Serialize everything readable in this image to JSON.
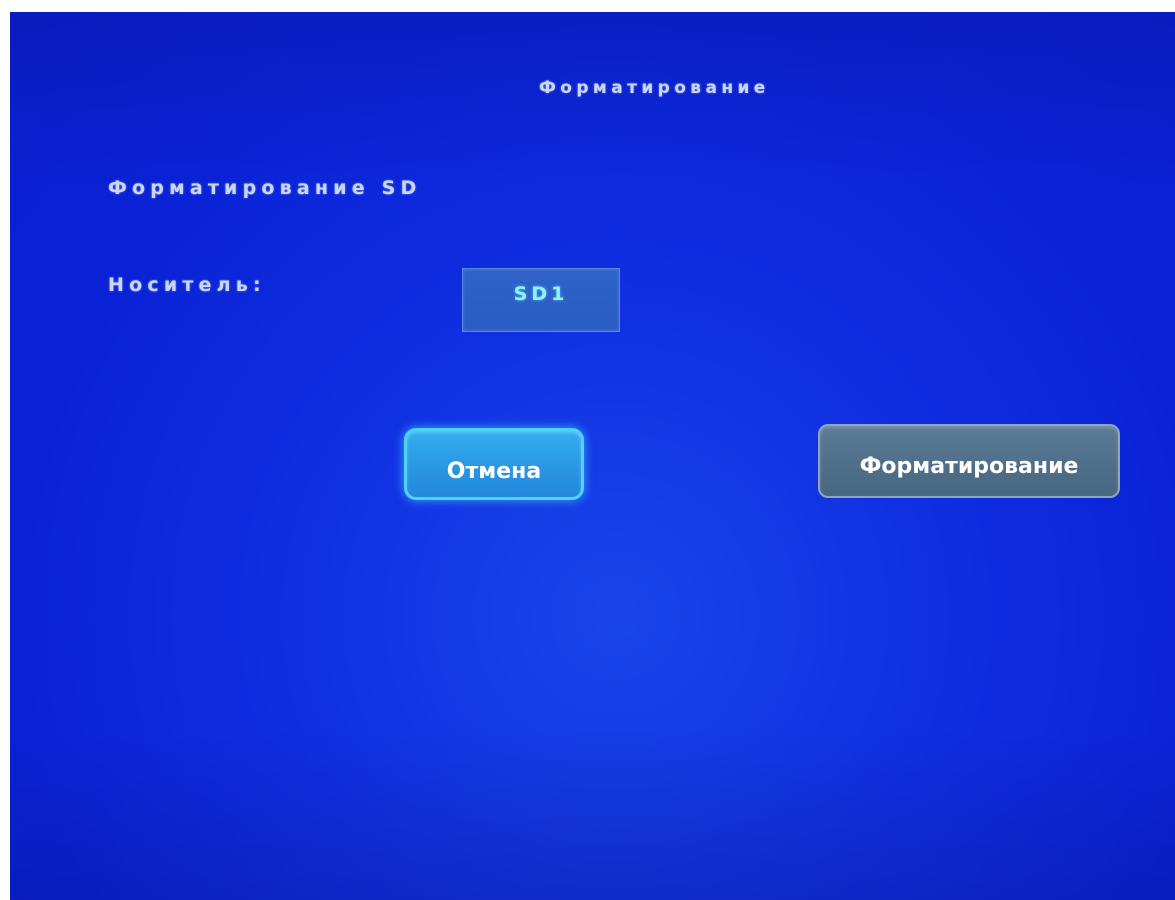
{
  "dialog": {
    "title": "Форматирование"
  },
  "section": {
    "label": "Форматирование SD"
  },
  "media": {
    "label": "Носитель:",
    "selected_value": "SD1"
  },
  "buttons": {
    "cancel_label": "Отмена",
    "format_label": "Форматирование"
  },
  "colors": {
    "background": "#0f2fe1",
    "text": "#c9d6f7",
    "cancel_button_focused": "#2a97e3",
    "format_button": "#4f6f8a",
    "select_value": "#8ff2ff"
  }
}
